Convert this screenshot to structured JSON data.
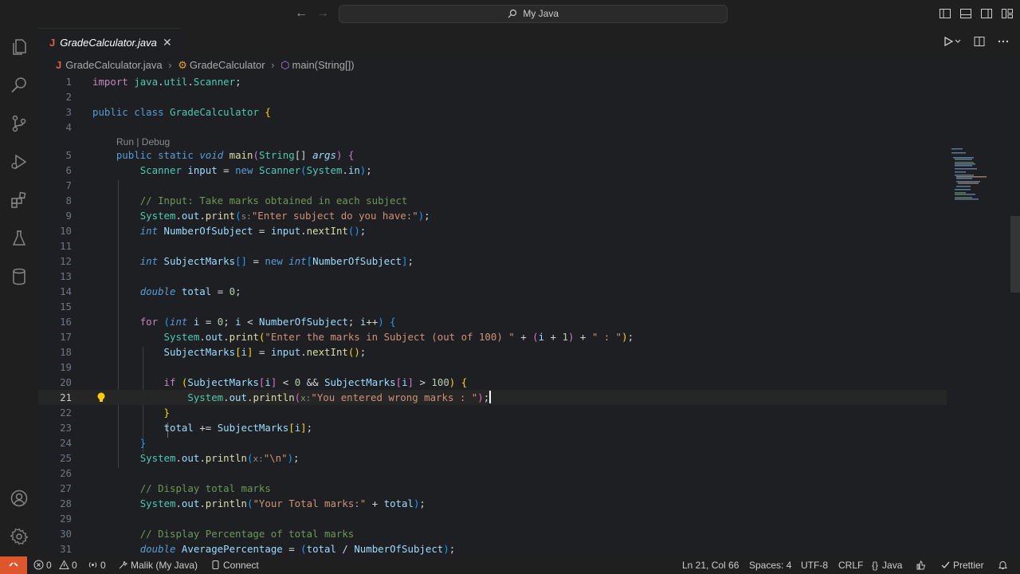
{
  "titlebar": {
    "search_text": "My Java",
    "back_glyph": "←",
    "forward_glyph": "→"
  },
  "tab": {
    "file_icon": "J",
    "label": "GradeCalculator.java",
    "close": "✕"
  },
  "breadcrumb": {
    "file": "GradeCalculator.java",
    "class": "GradeCalculator",
    "method": "main(String[])",
    "file_icon": "J",
    "class_icon": "⚙",
    "method_icon": "⬡",
    "sep": "›"
  },
  "codelens": "Run | Debug",
  "line_numbers": [
    "1",
    "2",
    "3",
    "4",
    "5",
    "6",
    "7",
    "8",
    "9",
    "10",
    "11",
    "12",
    "13",
    "14",
    "15",
    "16",
    "17",
    "18",
    "19",
    "20",
    "21",
    "22",
    "23",
    "24",
    "25",
    "26",
    "27",
    "28",
    "29",
    "30",
    "31"
  ],
  "statusbar": {
    "errors": "0",
    "warnings": "0",
    "ports": "0",
    "profile": "Malik (My Java)",
    "connect": "Connect",
    "position": "Ln 21, Col 66",
    "spaces": "Spaces: 4",
    "encoding": "UTF-8",
    "eol": "CRLF",
    "language": "Java",
    "formatter": "Prettier"
  },
  "colors": {
    "accent_remote": "#e0562c",
    "background": "#1e1f22"
  }
}
